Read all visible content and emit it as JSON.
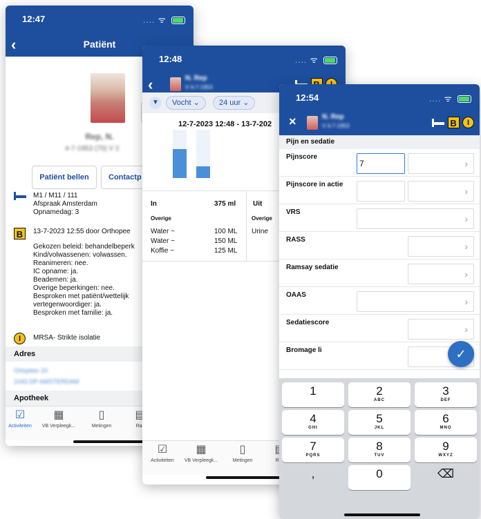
{
  "phone1": {
    "time": "12:47",
    "title": "Patiënt",
    "patient_name": "Rep, N.",
    "patient_dob": "4-7-1953 (70) V 2",
    "buttons": {
      "call": "Patiënt bellen",
      "contact": "Contactp"
    },
    "location": {
      "line1": "M1 / M11 / 111",
      "line2": "Afspraak Amsterdam",
      "line3": "Opnamedag: 3"
    },
    "beleid": {
      "header": "13-7-2023 12:55 door Orthopee",
      "lines": [
        "Gekozen beleid: behandelbeperk",
        "Kind/volwassenen: volwassen.",
        "Reanimeren: nee.",
        "IC opname: ja.",
        "Beademen: ja.",
        "Overige beperkingen: nee.",
        "Besproken met patiënt/wettelijk",
        "vertegenwoordiger: ja.",
        "Besproken met familie: ja."
      ]
    },
    "isolation": "MRSA- Strikte isolatie",
    "address_header": "Adres",
    "address_lines": [
      "Ortoplein 10",
      "1043 DP AMSTERDAM"
    ],
    "pharmacy_header": "Apotheek",
    "tabs": [
      "Activiteiten",
      "VB Verpleegk...",
      "Metingen",
      "Rap"
    ]
  },
  "phone2": {
    "time": "12:48",
    "patient_name": "N. Rep",
    "patient_dob": "V 4-7-1953",
    "filter_vocht": "Vocht",
    "filter_period": "24 uur",
    "date_range": "12-7-2023 12:48 - 13-7-202",
    "chart_data": {
      "type": "bar",
      "categories": [
        "In",
        "Uit"
      ],
      "values": [
        375,
        150
      ],
      "ylim": [
        0,
        620
      ]
    },
    "in_label": "In",
    "in_total": "375 ml",
    "out_label": "Uit",
    "overige": "Overige",
    "in_items": [
      {
        "name": "Water ~",
        "value": "100 ML"
      },
      {
        "name": "Water ~",
        "value": "150 ML"
      },
      {
        "name": "Koffie ~",
        "value": "125 ML"
      }
    ],
    "out_items": [
      "Urine"
    ],
    "tabs": [
      "Activiteiten",
      "VB Verpleegk...",
      "Metingen",
      "Rap"
    ]
  },
  "phone3": {
    "time": "12:54",
    "patient_name": "N. Rep",
    "patient_dob": "V 4-7-1953",
    "section": "Pijn en sedatie",
    "rows": [
      {
        "label": "Pijnscore",
        "value": "7"
      },
      {
        "label": "Pijnscore in actie",
        "value": ""
      },
      {
        "label": "VRS",
        "value": ""
      },
      {
        "label": "RASS",
        "value": ""
      },
      {
        "label": "Ramsay sedatie",
        "value": ""
      },
      {
        "label": "OAAS",
        "value": ""
      },
      {
        "label": "Sedatiescore",
        "value": ""
      },
      {
        "label": "Bromage li",
        "value": ""
      }
    ],
    "keys": [
      {
        "n": "1",
        "l": ""
      },
      {
        "n": "2",
        "l": "ABC"
      },
      {
        "n": "3",
        "l": "DEF"
      },
      {
        "n": "4",
        "l": "GHI"
      },
      {
        "n": "5",
        "l": "JKL"
      },
      {
        "n": "6",
        "l": "MNO"
      },
      {
        "n": "7",
        "l": "PQRS"
      },
      {
        "n": "8",
        "l": "TUV"
      },
      {
        "n": "9",
        "l": "WXYZ"
      },
      {
        "n": ",",
        "l": ""
      },
      {
        "n": "0",
        "l": ""
      },
      {
        "n": "⌫",
        "l": ""
      }
    ]
  },
  "icons": {
    "bed": "bed-icon",
    "badge_b": "B",
    "badge_i": "I",
    "back": "‹",
    "close": "×",
    "chevron": "›",
    "check": "✓",
    "filter": "▼"
  },
  "colors": {
    "header": "#1e4f9e",
    "accent": "#2d6fc5",
    "badge": "#f3c318",
    "bar": "#4a90d9"
  }
}
